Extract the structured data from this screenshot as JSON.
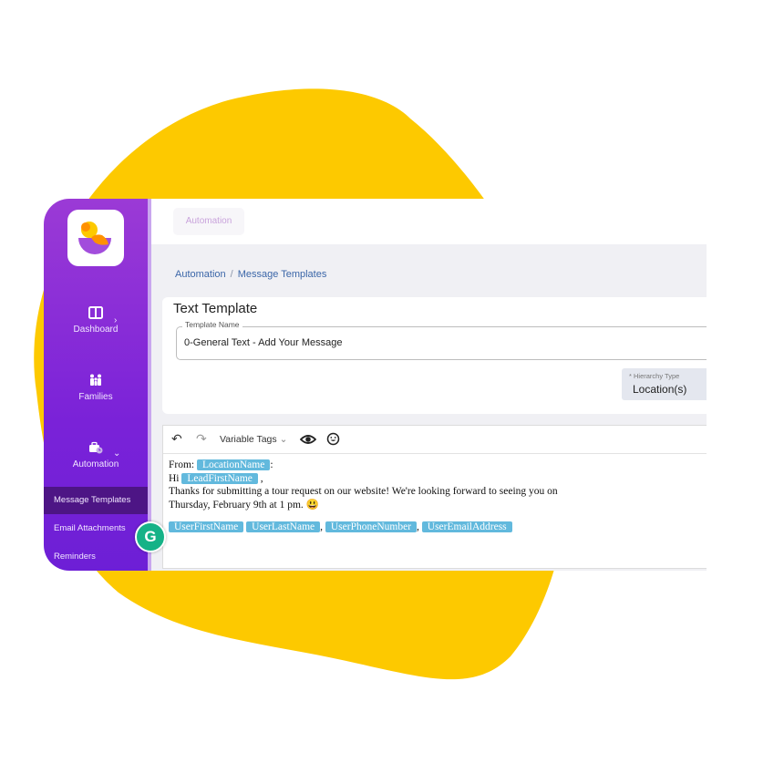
{
  "colors": {
    "blob": "#fdc900",
    "sidebar_top": "#9b3ad6",
    "sidebar_bottom": "#6d1fd6",
    "sidebar_active": "#4d1585",
    "tag_bg": "#62b9dd",
    "breadcrumb": "#3b66a8",
    "grammarly": "#16b287"
  },
  "sidebar": {
    "logo": "brand-logo",
    "items": [
      {
        "label": "Dashboard",
        "icon": "layout-icon"
      },
      {
        "label": "Families",
        "icon": "family-icon"
      },
      {
        "label": "Automation",
        "icon": "briefcase-clock-icon"
      }
    ],
    "subitems": [
      {
        "label": "Message Templates",
        "active": true
      },
      {
        "label": "Email Attachments",
        "active": false
      },
      {
        "label": "Reminders",
        "active": false
      }
    ]
  },
  "topbar": {
    "tab": "Automation"
  },
  "breadcrumb": {
    "items": [
      "Automation",
      "Message Templates"
    ],
    "separator": "/"
  },
  "form": {
    "title": "Text Template",
    "template_name_label": "Template Name",
    "template_name_value": "0-General Text - Add Your Message",
    "hierarchy_label": "* Hierarchy Type",
    "hierarchy_value": "Location(s)"
  },
  "editor": {
    "toolbar": {
      "undo": "undo-icon",
      "redo": "redo-icon",
      "variable_tags": "Variable Tags",
      "preview": "eye-icon",
      "emoji": "smiley-icon"
    },
    "line1_prefix": "From:",
    "line1_tag": "LocationName",
    "line1_suffix": ":",
    "line2_prefix": "Hi",
    "line2_tag": "LeadFirstName",
    "line2_suffix": ",",
    "line3": "Thanks for submitting a tour request on our website! We're looking forward to seeing you on",
    "line4": "Thursday, February 9th at 1 pm.",
    "line4_emoji": "😃",
    "tags": [
      "UserFirstName",
      "UserLastName",
      "UserPhoneNumber",
      "UserEmailAddress"
    ],
    "tag_separators": [
      "",
      ",",
      ","
    ]
  },
  "grammarly": {
    "letter": "G"
  }
}
